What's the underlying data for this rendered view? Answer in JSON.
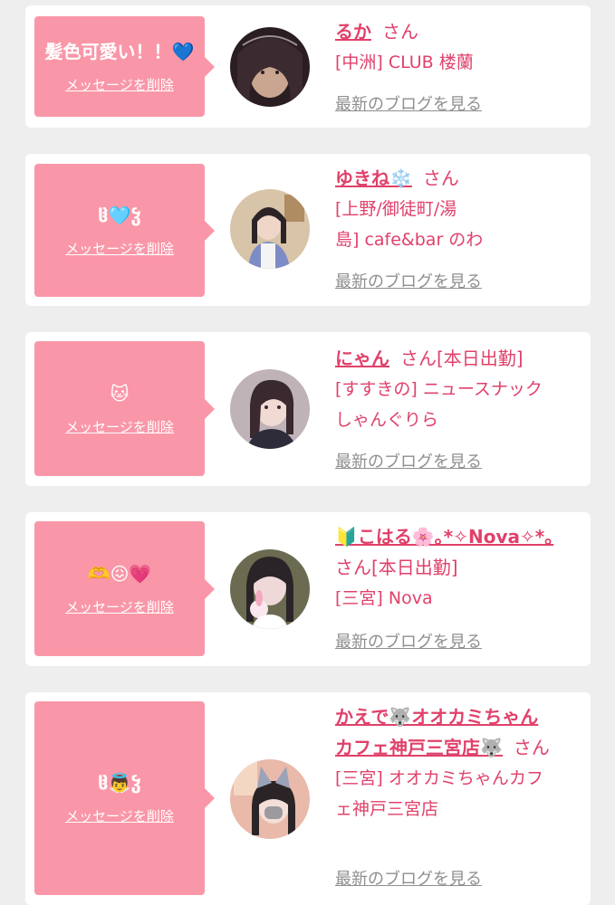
{
  "delete_label": "メッセージを削除",
  "blog_label": "最新のブログを見る",
  "san_label": "さん",
  "colors": {
    "background": "#eeeeee",
    "card": "#ffffff",
    "bubble": "#f997a8",
    "name": "#e0416a",
    "blog_link": "#8f8f8f"
  },
  "icons": {
    "avatar_1": "portrait-veil-icon",
    "avatar_2": "portrait-cafe-icon",
    "avatar_3": "portrait-girl-icon",
    "avatar_4": "portrait-bear-icon",
    "avatar_5": "portrait-cat-ears-icon"
  },
  "entries": [
    {
      "message": "髪色可愛い！！💙",
      "name": "るか",
      "status": "",
      "shop_lines": [
        "[中洲] CLUB 楼蘭"
      ]
    },
    {
      "message": "ჱ̒🩵ჴ",
      "name": "ゆきね❄️",
      "status": "",
      "shop_lines": [
        "[上野/御徒町/湯",
        "島] cafe&bar のわ"
      ]
    },
    {
      "message": "🐱",
      "name": "にゃん",
      "status": "[本日出勤]",
      "shop_lines": [
        "[すすきの] ニュースナック",
        "しゃんぐりら"
      ]
    },
    {
      "message": "🫶😖💗",
      "name": "🔰こはる🌸｡*✧Nova✧*｡",
      "status": "[本日出勤]",
      "shop_lines": [
        "[三宮] Nova"
      ]
    },
    {
      "message": "ჱ̒👼ჴ",
      "name_lines": [
        "かえで🐺オオカミちゃん",
        "カフェ神戸三宮店🐺"
      ],
      "status": "",
      "shop_lines": [
        "[三宮] オオカミちゃんカフ",
        "ェ神戸三宮店"
      ]
    }
  ]
}
